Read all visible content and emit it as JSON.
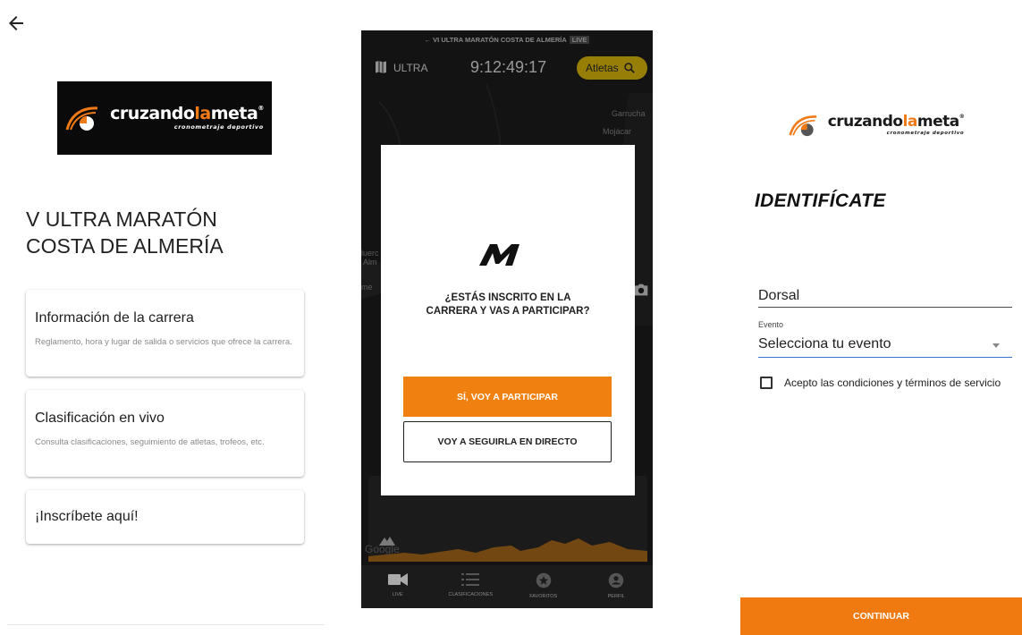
{
  "screen1": {
    "logo": {
      "word_part1": "cruzando",
      "word_part2": "la",
      "word_part3": "meta",
      "registered": "®",
      "tagline": "cronometraje deportivo"
    },
    "race_title_line1": "V ULTRA MARATÓN",
    "race_title_line2": "COSTA DE ALMERÍA",
    "cards": [
      {
        "title": "Información de la carrera",
        "description": "Reglamento, hora y lugar de salida o servicios que ofrece la carrera."
      },
      {
        "title": "Clasificación en vivo",
        "description": "Consulta clasificaciones, seguimiento de atletas, trofeos, etc."
      },
      {
        "title": "¡Inscríbete aquí!"
      }
    ]
  },
  "screen2": {
    "top_title": "← VI ULTRA MARATÓN COSTA DE ALMERÍA",
    "top_tag": "LIVE",
    "race_label": "ULTRA",
    "clock": "9:12:49:17",
    "athletes_button": "Atletas",
    "map_labels": [
      "Garrucha",
      "Mojácar",
      "luerc",
      "Alm",
      "me"
    ],
    "google_watermark": "Google",
    "modal": {
      "question_line1": "¿ESTÁS INSCRITO EN LA",
      "question_line2": "CARRERA Y VAS A PARTICIPAR?",
      "yes_button": "SÍ, VOY A PARTICIPAR",
      "live_button": "VOY A SEGUIRLA EN DIRECTO"
    },
    "tabs": [
      {
        "label": "LIVE",
        "icon": "video-camera-icon"
      },
      {
        "label": "CLASIFICACIONES",
        "icon": "list-icon"
      },
      {
        "label": "FAVORITOS",
        "icon": "star-icon"
      },
      {
        "label": "PERFIL",
        "icon": "account-icon"
      }
    ],
    "colors": {
      "accent": "#f08110",
      "athletes_button": "#e9c20c"
    }
  },
  "screen3": {
    "logo": {
      "word_part1": "cruzando",
      "word_part2": "la",
      "word_part3": "meta",
      "registered": "®",
      "tagline": "cronometraje deportivo"
    },
    "heading": "IDENTIFÍCATE",
    "dorsal_placeholder": "Dorsal",
    "event_label": "Evento",
    "event_value": "Selecciona tu evento",
    "terms_label": "Acepto las condiciones y términos de servicio",
    "continue_button": "CONTINUAR",
    "colors": {
      "accent": "#f07a10",
      "select_underline": "#3b72c6"
    }
  }
}
